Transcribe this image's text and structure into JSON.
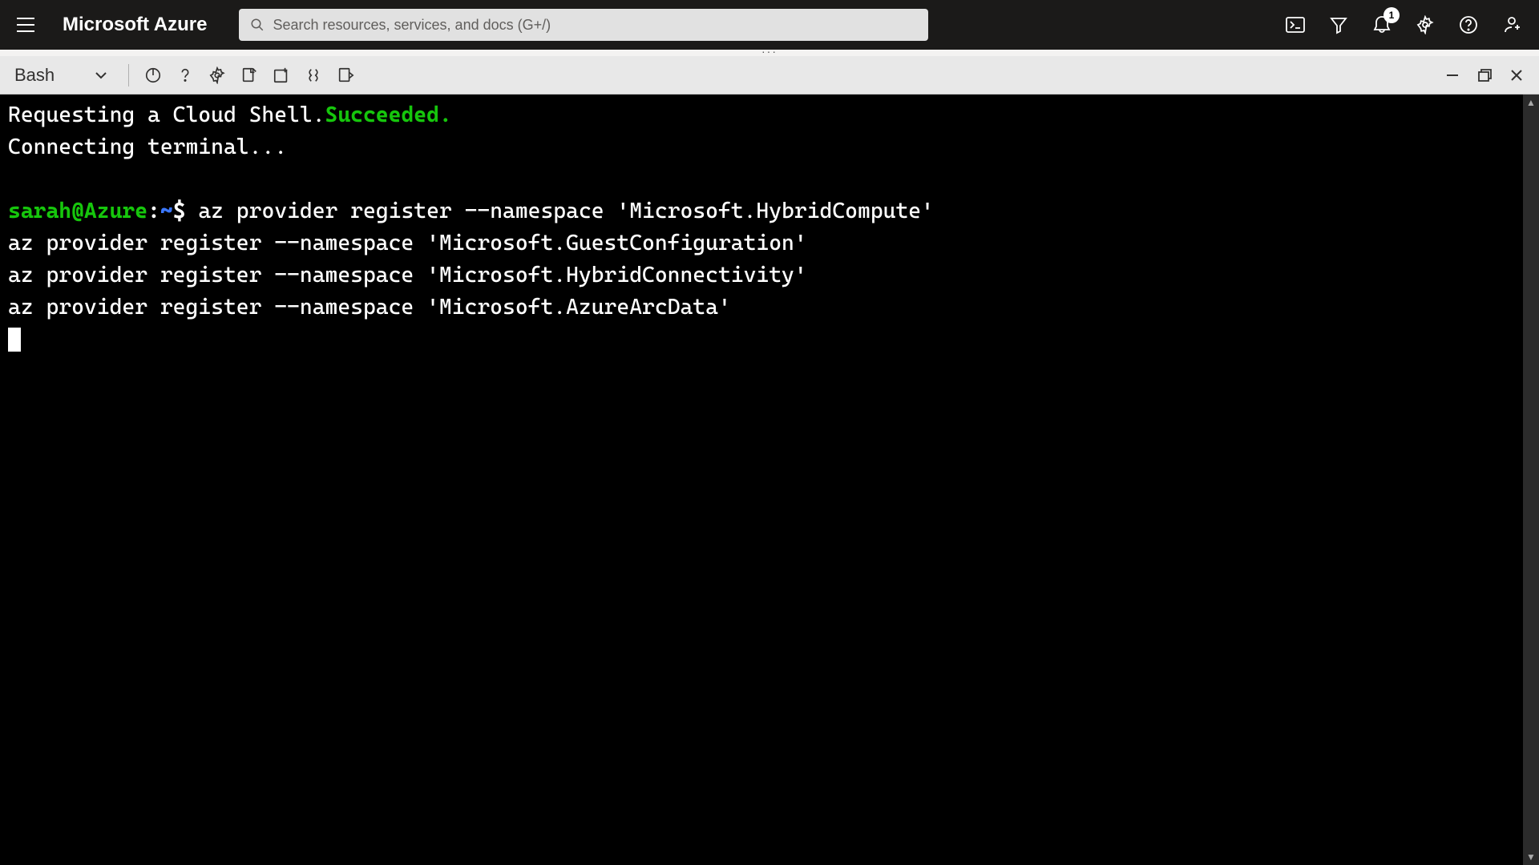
{
  "header": {
    "brand": "Microsoft Azure",
    "search_placeholder": "Search resources, services, and docs (G+/)",
    "notification_count": "1"
  },
  "shell_bar": {
    "shell_type": "Bash"
  },
  "terminal": {
    "line1_a": "Requesting a Cloud Shell.",
    "line1_b": "Succeeded.",
    "line2": "Connecting terminal...",
    "prompt_user": "sarah@Azure",
    "prompt_colon": ":",
    "prompt_path": "~",
    "prompt_dollar": "$",
    "cmd1": " az provider register --namespace 'Microsoft.HybridCompute'",
    "cmd2": "az provider register --namespace 'Microsoft.GuestConfiguration'",
    "cmd3": "az provider register --namespace 'Microsoft.HybridConnectivity'",
    "cmd4": "az provider register --namespace 'Microsoft.AzureArcData'"
  }
}
